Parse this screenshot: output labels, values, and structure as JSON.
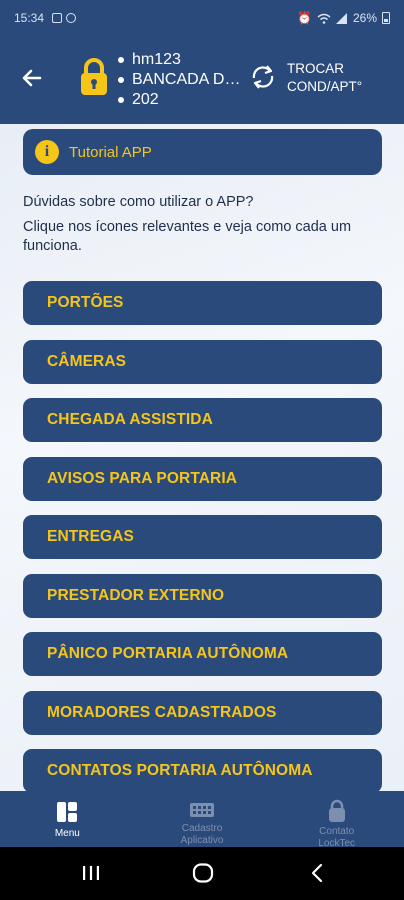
{
  "status_bar": {
    "time": "15:34",
    "battery": "26%"
  },
  "header": {
    "user": "hm123",
    "condo": "BANCADA D…",
    "apartment": "202",
    "switch_label_line1": "TROCAR",
    "switch_label_line2": "COND/APT°"
  },
  "tutorial": {
    "label": "Tutorial APP"
  },
  "help": {
    "question": "Dúvidas sobre como utilizar o APP?",
    "instruction": "Clique nos ícones relevantes e veja como cada um funciona."
  },
  "menu_items": [
    {
      "label": "PORTÕES"
    },
    {
      "label": "CÂMERAS"
    },
    {
      "label": "CHEGADA ASSISTIDA"
    },
    {
      "label": "AVISOS PARA PORTARIA"
    },
    {
      "label": "ENTREGAS"
    },
    {
      "label": "PRESTADOR EXTERNO"
    },
    {
      "label": "PÂNICO PORTARIA AUTÔNOMA"
    },
    {
      "label": "MORADORES CADASTRADOS"
    },
    {
      "label": "CONTATOS PORTARIA AUTÔNOMA"
    }
  ],
  "bottom_nav": {
    "menu": "Menu",
    "cadastro_line1": "Cadastro",
    "cadastro_line2": "Aplicativo",
    "contato_line1": "Contato",
    "contato_line2": "LockTec"
  },
  "colors": {
    "primary": "#2b4a7c",
    "accent": "#f5c518"
  },
  "icons": [
    "back-arrow-icon",
    "padlock-icon",
    "swap-icon",
    "info-icon",
    "grid-icon",
    "keypad-icon",
    "lock-icon"
  ]
}
